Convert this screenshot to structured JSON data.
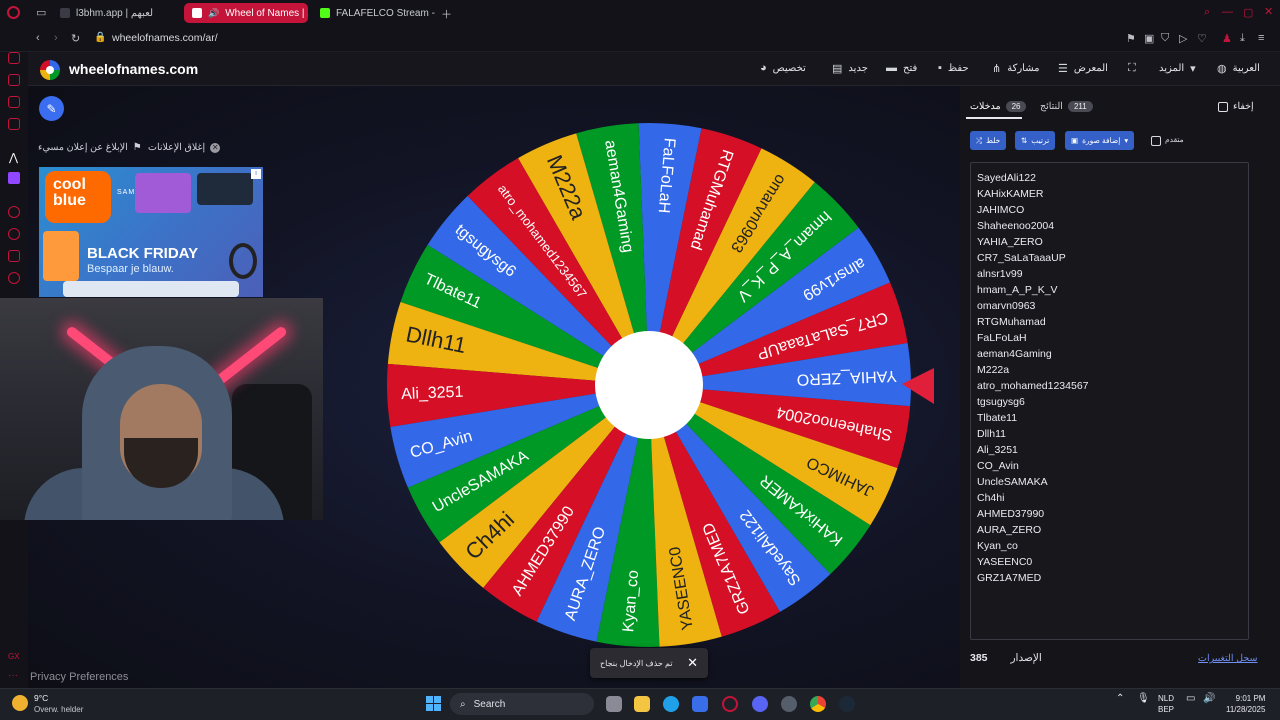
{
  "browser": {
    "tabs": [
      {
        "label": "l3bhm.app | لعبهم",
        "active": false,
        "color": "#3b3b46"
      },
      {
        "label": "Wheel of Names | الي",
        "active": true,
        "color": "#ffffff"
      },
      {
        "label": "FALAFELCO Stream - Wat",
        "active": false,
        "color": "#53fc18"
      }
    ],
    "url": "wheelofnames.com/ar/"
  },
  "site": {
    "logo_text": "wheelofnames.com",
    "nav": {
      "customize": "تخصيص",
      "new": "جديد",
      "open": "فتح",
      "save": "حفظ",
      "share": "مشاركة",
      "gallery": "المعرض",
      "more": "المزيد",
      "language": "العربية"
    },
    "ads": {
      "close_ads": "إغلاق الإعلانات",
      "report_ad": "الإبلاغ عن إعلان مسيء"
    },
    "ad_banner": {
      "logo": "cool blue",
      "brand": "SAMSUNG",
      "title": "BLACK FRIDAY",
      "subtitle": "Bespaar je blauw."
    },
    "privacy": "Privacy Preferences",
    "toast": "تم حذف الإدخال بنجاح"
  },
  "wheel": {
    "colors": [
      "#d50f25",
      "#3369e8",
      "#009925",
      "#eeb211"
    ],
    "segments": [
      "CR7_SaLaTaaaUP",
      "alnsr1v99",
      "hmam_A_P_K_V",
      "omarvn0963",
      "RTGMuhamad",
      "FaLFoLaH",
      "aeman4Gaming",
      "M222a",
      "atro_mohamed1234567",
      "tgsugysg6",
      "Tlbate11",
      "Dllh11",
      "Ali_3251",
      "CO_Avin",
      "UncleSAMAKA",
      "Ch4hi",
      "AHMED37990",
      "AURA_ZERO",
      "Kyan_co",
      "YASEENC0",
      "GRZ1A7MED",
      "SayedAli122",
      "KAHixKAMER",
      "JAHIMCO",
      "Shaheenoo2004",
      "YAHIA_ZERO"
    ]
  },
  "panel": {
    "hide_label": "إخفاء",
    "tab_entries": "مدخلات",
    "entries_count": "26",
    "tab_results": "النتائج",
    "results_count": "211",
    "shuffle": "خلط",
    "sort": "ترتيب",
    "add_image": "إضافة صورة",
    "advanced": "متقدم",
    "entries": [
      "SayedAli122",
      "KAHixKAMER",
      "JAHIMCO",
      "Shaheenoo2004",
      "YAHIA_ZERO",
      "CR7_SaLaTaaaUP",
      "alnsr1v99",
      "hmam_A_P_K_V",
      "omarvn0963",
      "RTGMuhamad",
      "FaLFoLaH",
      "aeman4Gaming",
      "M222a",
      "atro_mohamed1234567",
      "tgsugysg6",
      "Tlbate11",
      "Dllh11",
      "Ali_3251",
      "CO_Avin",
      "UncleSAMAKA",
      "Ch4hi",
      "AHMED37990",
      "AURA_ZERO",
      "Kyan_co",
      "YASEENC0",
      "GRZ1A7MED"
    ],
    "version_label": "الإصدار",
    "version_number": "385",
    "changelog": "سجل التغييرات"
  },
  "taskbar": {
    "weather_temp": "9°C",
    "weather_desc": "Overw. helder",
    "search": "Search",
    "lang": "NLD",
    "layout": "BEP",
    "time": "9:01 PM",
    "date": "11/28/2025"
  }
}
